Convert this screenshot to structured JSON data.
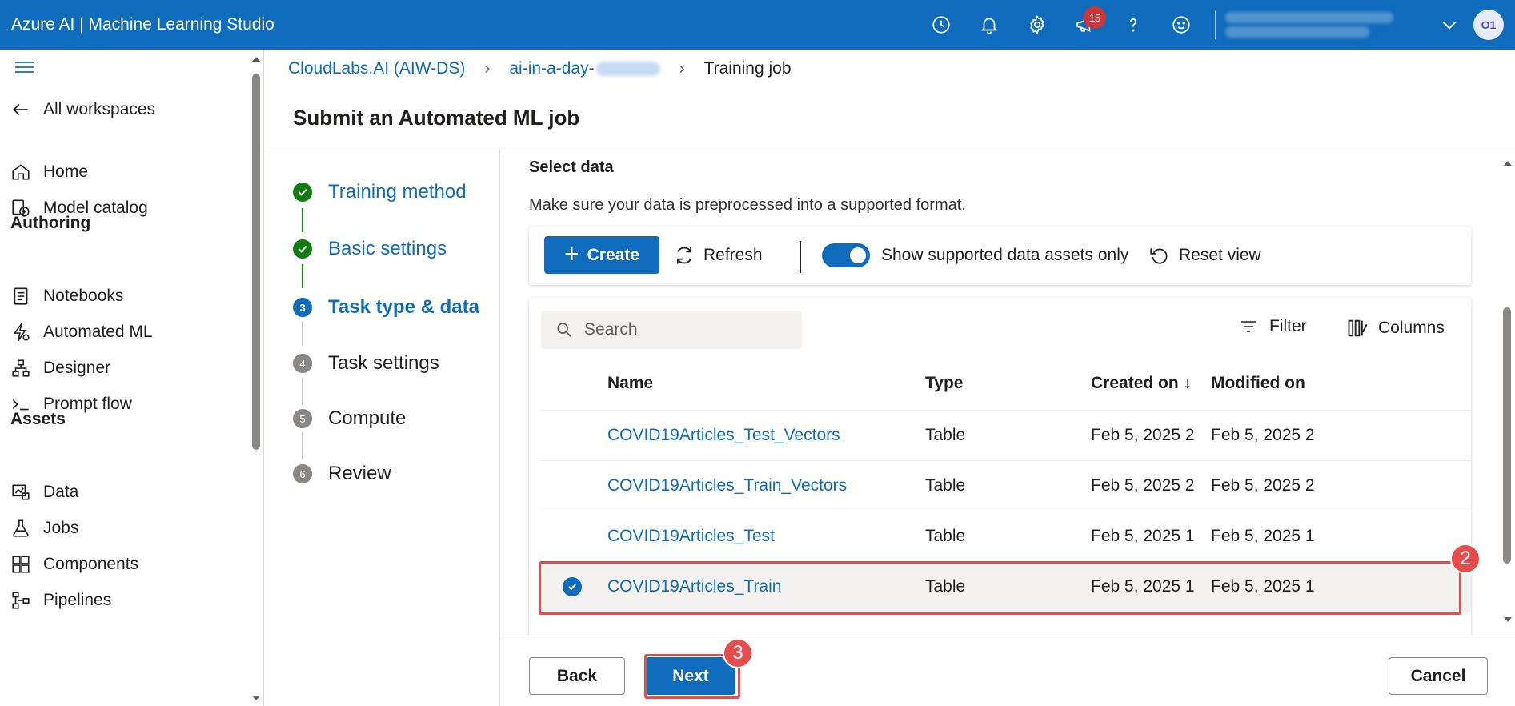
{
  "app": {
    "title": "Azure AI | Machine Learning Studio"
  },
  "topbar": {
    "notification_count": "15",
    "avatar_initials": "O1"
  },
  "sidebar": {
    "back_label": "All workspaces",
    "items": [
      {
        "label": "Home",
        "icon": "home-icon"
      },
      {
        "label": "Model catalog",
        "icon": "model-catalog-icon"
      },
      {
        "label": "Notebooks",
        "icon": "notebook-icon"
      },
      {
        "label": "Automated ML",
        "icon": "automl-icon"
      },
      {
        "label": "Designer",
        "icon": "designer-icon"
      },
      {
        "label": "Prompt flow",
        "icon": "prompt-flow-icon"
      },
      {
        "label": "Data",
        "icon": "data-icon"
      },
      {
        "label": "Jobs",
        "icon": "jobs-icon"
      },
      {
        "label": "Components",
        "icon": "components-icon"
      },
      {
        "label": "Pipelines",
        "icon": "pipelines-icon"
      }
    ],
    "sections": {
      "authoring": "Authoring",
      "assets": "Assets"
    }
  },
  "breadcrumb": {
    "workspace": "CloudLabs.AI (AIW-DS)",
    "resource": "ai-in-a-day-",
    "current": "Training job"
  },
  "page": {
    "title": "Submit an Automated ML job"
  },
  "stepper": [
    {
      "label": "Training method",
      "state": "done",
      "number": ""
    },
    {
      "label": "Basic settings",
      "state": "done",
      "number": ""
    },
    {
      "label": "Task type & data",
      "state": "active",
      "number": "3"
    },
    {
      "label": "Task settings",
      "state": "todo",
      "number": "4"
    },
    {
      "label": "Compute",
      "state": "todo",
      "number": "5"
    },
    {
      "label": "Review",
      "state": "todo",
      "number": "6"
    }
  ],
  "content": {
    "title": "Select data",
    "description": "Make sure your data is preprocessed into a supported format."
  },
  "toolbar": {
    "create": "Create",
    "refresh": "Refresh",
    "toggle_label": "Show supported data assets only",
    "toggle_on": true,
    "reset": "Reset view"
  },
  "table": {
    "search_placeholder": "Search",
    "filter": "Filter",
    "columns": "Columns",
    "headers": {
      "name": "Name",
      "type": "Type",
      "created": "Created on ↓",
      "modified": "Modified on"
    },
    "rows": [
      {
        "name": "COVID19Articles_Test_Vectors",
        "type": "Table",
        "created": "Feb 5, 2025 2:...",
        "modified": "Feb 5, 2025 2:...",
        "selected": false
      },
      {
        "name": "COVID19Articles_Train_Vectors",
        "type": "Table",
        "created": "Feb 5, 2025 2:...",
        "modified": "Feb 5, 2025 2:...",
        "selected": false
      },
      {
        "name": "COVID19Articles_Test",
        "type": "Table",
        "created": "Feb 5, 2025 1...",
        "modified": "Feb 5, 2025 1...",
        "selected": false
      },
      {
        "name": "COVID19Articles_Train",
        "type": "Table",
        "created": "Feb 5, 2025 1...",
        "modified": "Feb 5, 2025 1...",
        "selected": true
      }
    ]
  },
  "footer": {
    "back": "Back",
    "next": "Next",
    "cancel": "Cancel"
  },
  "annotations": {
    "step2": "2",
    "step3": "3"
  },
  "colors": {
    "brand": "#0f6cbd",
    "success": "#107c10",
    "highlight": "#e74c4c"
  }
}
